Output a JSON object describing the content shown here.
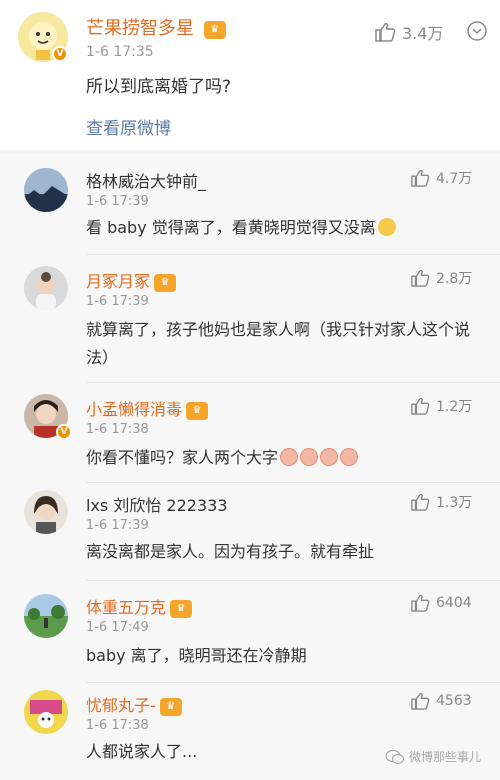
{
  "main_post": {
    "author": "芒果捞智多星",
    "time": "1-6 17:35",
    "text": "所以到底离婚了吗?",
    "likes": "3.4万",
    "view_original": "查看原微博"
  },
  "comments": [
    {
      "name": "格林威治大钟前_",
      "time": "1-6 17:39",
      "text": "看 baby 觉得离了，看黄晓明觉得又没离",
      "likes": "4.7万"
    },
    {
      "name": "月冢月冢",
      "time": "1-6 17:39",
      "text": "就算离了，孩子他妈也是家人啊（我只针对家人这个说法）",
      "likes": "2.8万"
    },
    {
      "name": "小孟懒得消毒",
      "time": "1-6 17:38",
      "text": "你看不懂吗？家人两个大字",
      "likes": "1.2万"
    },
    {
      "name": "lxs 刘欣怡 222333",
      "time": "1-6 17:39",
      "text": "离没离都是家人。因为有孩子。就有牵扯",
      "likes": "1.3万"
    },
    {
      "name": "体重五万克",
      "time": "1-6 17:49",
      "text": "baby 离了，晓明哥还在冷静期",
      "likes": "6404"
    },
    {
      "name": "忧郁丸子-",
      "time": "1-6 17:38",
      "text": "人都说家人了...",
      "likes": "4563"
    }
  ],
  "watermark": "微博那些事儿",
  "icons": {
    "like": "thumbs-up-icon",
    "more": "chevron-down-icon",
    "badge": "crown-badge-icon",
    "verified": "v-badge-icon"
  },
  "colors": {
    "vip_name": "#e66a1f",
    "link": "#5b7ba8",
    "meta": "#999999"
  }
}
